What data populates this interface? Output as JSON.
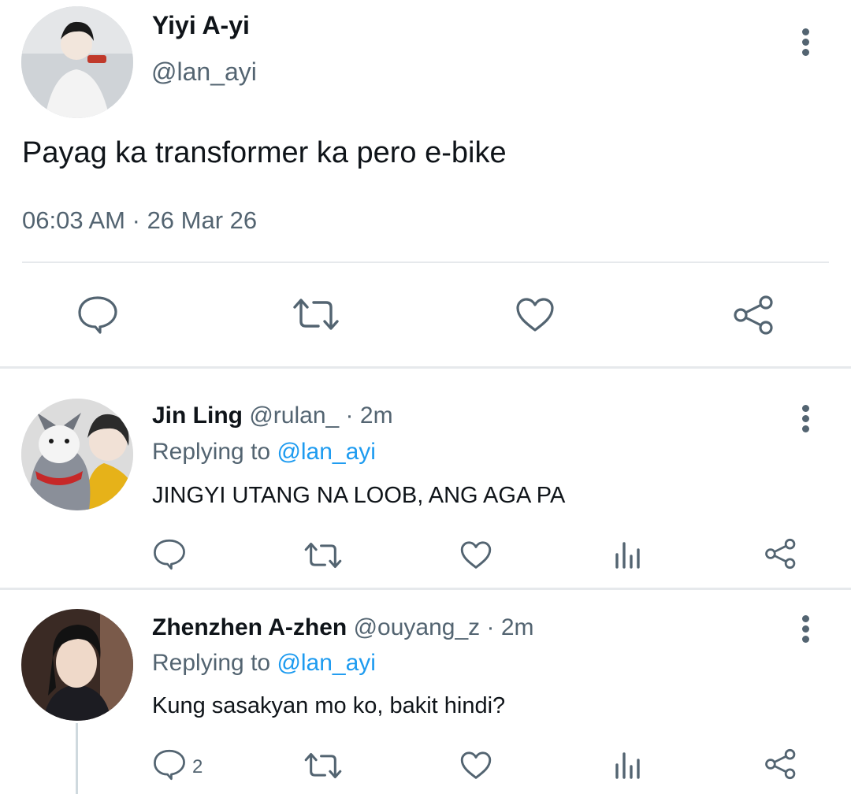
{
  "main_tweet": {
    "author_name": "Yiyi A-yi",
    "handle": "@lan_ayi",
    "text": "Payag ka transformer ka pero e-bike",
    "time": "06:03 AM",
    "separator": "·",
    "date": "26 Mar 26",
    "actions": [
      "reply-icon",
      "retweet-icon",
      "like-icon",
      "share-icon"
    ]
  },
  "replies": [
    {
      "author_name": "Jin Ling",
      "handle": "@rulan_",
      "separator": "·",
      "time": "2m",
      "replying_prefix": "Replying to",
      "replying_to": "@lan_ayi",
      "text": "JINGYI UTANG NA LOOB, ANG AGA PA",
      "reply_count": "",
      "actions": [
        "reply-icon",
        "retweet-icon",
        "like-icon",
        "analytics-icon",
        "share-icon"
      ]
    },
    {
      "author_name": "Zhenzhen A-zhen",
      "handle": "@ouyang_z",
      "separator": "·",
      "time": "2m",
      "replying_prefix": "Replying to",
      "replying_to": "@lan_ayi",
      "text": "Kung sasakyan mo ko, bakit hindi?",
      "reply_count": "2",
      "actions": [
        "reply-icon",
        "retweet-icon",
        "like-icon",
        "analytics-icon",
        "share-icon"
      ]
    }
  ],
  "colors": {
    "primary_text": "#0f1419",
    "secondary_text": "#536471",
    "link": "#1d9bf0",
    "divider": "#e6e9ec"
  }
}
